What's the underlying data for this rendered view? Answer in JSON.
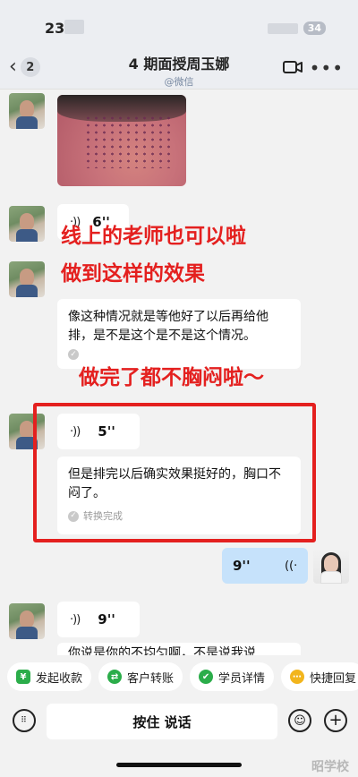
{
  "status_bar": {
    "time": "23",
    "battery": "34"
  },
  "header": {
    "unread_count": "2",
    "title": "4 期面授周玉娜",
    "subtitle": "@微信",
    "video_icon": "video-camera-icon",
    "more_icon": "more-dots-icon"
  },
  "messages": {
    "voice_1_duration": "6''",
    "transcript_1": "像这种情况就是等他好了以后再给他排，是不是这个是不是这个情况。",
    "voice_2_duration": "5''",
    "transcript_2": "但是排完以后确实效果挺好的，胸口不闷了。",
    "convert_status": "转换完成",
    "self_voice_duration": "9''",
    "voice_3_duration": "9''",
    "transcript_3_partial": "你说是你的不均匀啊，不是说我说"
  },
  "overlay": {
    "line1": "线上的老师也可以啦",
    "line2": "做到这样的效果",
    "line3": "做完了都不胸闷啦～"
  },
  "quick_actions": [
    {
      "label": "发起收款",
      "icon": "payment-icon",
      "color": "#2bad4a"
    },
    {
      "label": "客户转账",
      "icon": "transfer-icon",
      "color": "#2bad4a"
    },
    {
      "label": "学员详情",
      "icon": "student-icon",
      "color": "#2bad4a"
    },
    {
      "label": "快捷回复",
      "icon": "quick-reply-icon",
      "color": "#f2b51c"
    }
  ],
  "input": {
    "hold_to_talk": "按住 说话"
  },
  "watermark": "昭学校"
}
